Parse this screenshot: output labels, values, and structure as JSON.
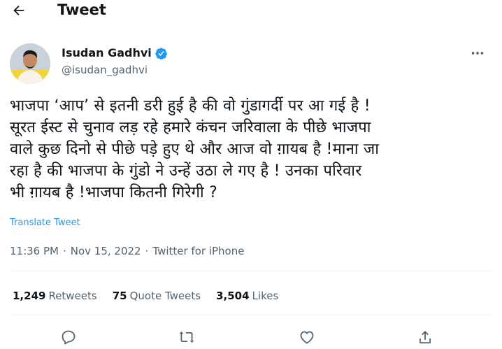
{
  "header": {
    "title": "Tweet",
    "back_icon": "back-arrow-icon"
  },
  "author": {
    "name": "Isudan Gadhvi",
    "handle": "@isudan_gadhvi",
    "verified_color": "#1d9bf0"
  },
  "tweet": {
    "text": "भाजपा ‘आप’ से इतनी डरी हुई है की वो गुंडागर्दी पर आ गई है !\nसूरत ईस्ट से चुनाव लड़ रहे हमारे कंचन जरिवाला के पीछे भाजपा\nवाले कुछ दिनो से पीछे पड़े हुए थे और आज वो ग़ायब है !माना जा\nरहा है की भाजपा के गुंडो ने उन्हें उठा ले गए है ! उनका परिवार\nभी ग़ायब है !भाजपा कितनी गिरेगी ?",
    "translate_label": "Translate Tweet"
  },
  "meta": {
    "time": "11:36 PM",
    "separator": "·",
    "date": "Nov 15, 2022",
    "source": "Twitter for iPhone"
  },
  "stats": {
    "retweets_count": "1,249",
    "retweets_label": "Retweets",
    "quotes_count": "75",
    "quotes_label": "Quote Tweets",
    "likes_count": "3,504",
    "likes_label": "Likes"
  },
  "colors": {
    "link": "#1d9bf0",
    "secondary": "#536471",
    "divider": "#eff3f4"
  }
}
